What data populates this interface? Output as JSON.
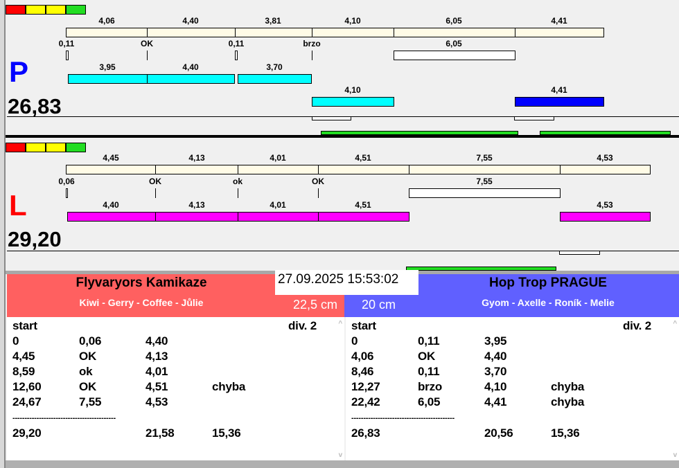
{
  "colors": {
    "red": "#ff0000",
    "yellow": "#ffff00",
    "green": "#22dd22",
    "p_color": "#0000ff",
    "l_color": "#ff0000",
    "left_header": "#ff6060",
    "right_header": "#6060ff"
  },
  "P": {
    "letter": "P",
    "total": "26,83",
    "top_labels": [
      "4,06",
      "4,40",
      "3,81",
      "4,10",
      "6,05",
      "4,41"
    ],
    "mid_labels": [
      "0,11",
      "OK",
      "0,11",
      "brzo",
      "6,05"
    ],
    "lane_labels": [
      "3,95",
      "4,40",
      "3,70",
      "4,10",
      "4,41"
    ]
  },
  "L": {
    "letter": "L",
    "total": "29,20",
    "top_labels": [
      "4,45",
      "4,13",
      "4,01",
      "4,51",
      "7,55",
      "4,53"
    ],
    "mid_labels": [
      "0,06",
      "OK",
      "ok",
      "OK",
      "7,55"
    ],
    "lane_labels": [
      "4,40",
      "4,13",
      "4,01",
      "4,51",
      "4,53"
    ]
  },
  "datetime": "27.09.2025 15:53:02",
  "left_team": {
    "name": "Flyvaryors Kamikaze",
    "members": "Kiwi - Gerry - Coffee - Jůlie",
    "size": "22,5 cm",
    "header": [
      "start",
      "div. 2"
    ],
    "rows": [
      [
        "0",
        "0,06",
        "4,40",
        ""
      ],
      [
        "4,45",
        "OK",
        "4,13",
        ""
      ],
      [
        "8,59",
        "ok",
        "4,01",
        ""
      ],
      [
        "12,60",
        "OK",
        "4,51",
        "chyba"
      ],
      [
        "24,67",
        "7,55",
        "4,53",
        ""
      ]
    ],
    "separator": "-------------------------------------------",
    "totals": [
      "29,20",
      "",
      "21,58",
      "15,36"
    ]
  },
  "right_team": {
    "name": "Hop Trop PRAGUE",
    "members": "Gyom - Axelle - Roník - Melie",
    "size": "20 cm",
    "header": [
      "start",
      "div. 2"
    ],
    "rows": [
      [
        "0",
        "0,11",
        "3,95",
        ""
      ],
      [
        "4,06",
        "OK",
        "4,40",
        ""
      ],
      [
        "8,46",
        "0,11",
        "3,70",
        ""
      ],
      [
        "12,27",
        "brzo",
        "4,10",
        "chyba"
      ],
      [
        "22,42",
        "6,05",
        "4,41",
        "chyba"
      ]
    ],
    "separator": "-------------------------------------------",
    "totals": [
      "26,83",
      "",
      "20,56",
      "15,36"
    ]
  }
}
